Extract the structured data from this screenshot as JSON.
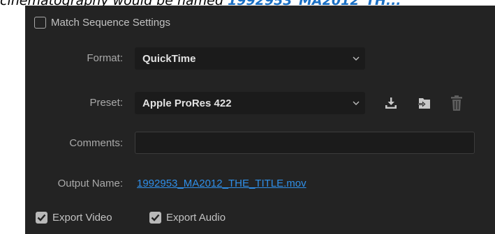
{
  "banner": {
    "prefix": "cinematography would be named ",
    "highlight": "1992953_MA2012_TH..."
  },
  "match_sequence": {
    "label": "Match Sequence Settings",
    "checked": false
  },
  "format": {
    "label": "Format:",
    "value": "QuickTime"
  },
  "preset": {
    "label": "Preset:",
    "value": "Apple ProRes 422"
  },
  "preset_actions": [
    "save-preset-icon",
    "import-preset-icon",
    "delete-preset-icon"
  ],
  "comments": {
    "label": "Comments:",
    "value": ""
  },
  "output_name": {
    "label": "Output Name:",
    "value": "1992953_MA2012_THE_TITLE.mov"
  },
  "export_video": {
    "label": "Export Video",
    "checked": true
  },
  "export_audio": {
    "label": "Export Audio",
    "checked": true
  },
  "colors": {
    "panel": "#232323",
    "field": "#1b1b1b",
    "link": "#2f8fe8"
  }
}
